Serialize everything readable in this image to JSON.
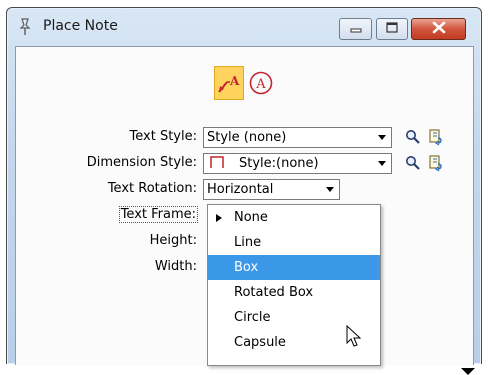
{
  "window": {
    "title": "Place Note"
  },
  "mode_buttons": [
    {
      "id": "place-note-arrow",
      "glyph": "A",
      "active": true
    },
    {
      "id": "place-note-circle",
      "glyph": "A",
      "active": false
    }
  ],
  "fields": {
    "text_style": {
      "label": "Text Style:",
      "value": "Style (none)"
    },
    "dimension_style": {
      "label": "Dimension Style:",
      "value": "Style:(none)"
    },
    "text_rotation": {
      "label": "Text Rotation:",
      "value": "Horizontal"
    },
    "text_frame": {
      "label": "Text Frame:"
    },
    "height": {
      "label": "Height:"
    },
    "width": {
      "label": "Width:"
    }
  },
  "text_frame_options": [
    {
      "label": "None",
      "checked": true,
      "highlighted": false
    },
    {
      "label": "Line",
      "checked": false,
      "highlighted": false
    },
    {
      "label": "Box",
      "checked": false,
      "highlighted": true
    },
    {
      "label": "Rotated Box",
      "checked": false,
      "highlighted": false
    },
    {
      "label": "Circle",
      "checked": false,
      "highlighted": false
    },
    {
      "label": "Capsule",
      "checked": false,
      "highlighted": false
    }
  ],
  "colors": {
    "active_mode": "#ffd35e",
    "highlight": "#3b98e8",
    "close_button": "#c13b22",
    "note_red": "#c1272d"
  },
  "icons": [
    "pin-icon",
    "minimize-icon",
    "maximize-icon",
    "close-icon",
    "magnifier-icon",
    "style-page-icon",
    "mouse-pointer-icon"
  ]
}
